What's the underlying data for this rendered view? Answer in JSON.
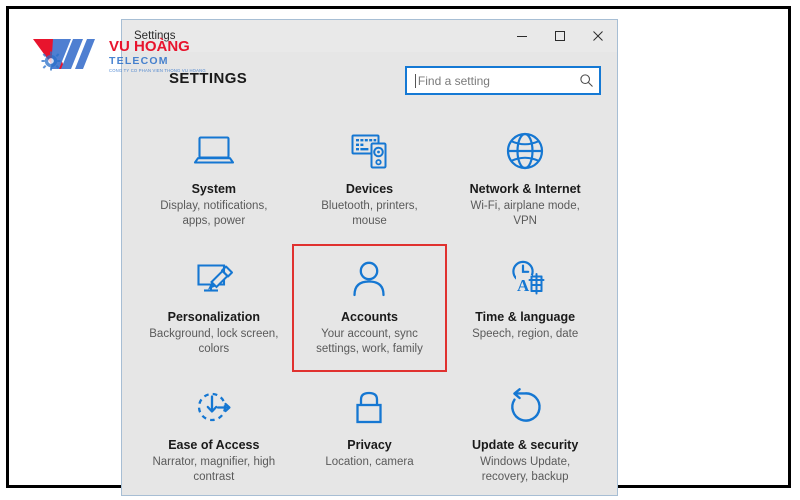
{
  "watermark": {
    "brand_line1_a": "VU ",
    "brand_line1_b": "HOÀNG",
    "brand_line2": "TELECOM",
    "brand_tagline": "CONG TY CO PHAN VIEN THONG VU HOANG",
    "color_red": "#e8142d",
    "color_blue": "#2a6fc9"
  },
  "window": {
    "title": "Settings",
    "controls": {
      "minimize": "minimize-icon",
      "maximize": "maximize-icon",
      "close": "close-icon"
    }
  },
  "header": {
    "title": "SETTINGS"
  },
  "search": {
    "value": "",
    "placeholder": "Find a setting",
    "icon": "search-icon",
    "accent_color": "#1579d4"
  },
  "accent_color": "#1577d2",
  "highlight_color": "#e0312f",
  "tiles": [
    {
      "id": "system",
      "icon": "laptop-icon",
      "title": "System",
      "desc": "Display, notifications, apps, power",
      "selected": false
    },
    {
      "id": "devices",
      "icon": "keyboard-device-icon",
      "title": "Devices",
      "desc": "Bluetooth, printers, mouse",
      "selected": false
    },
    {
      "id": "network-internet",
      "icon": "globe-icon",
      "title": "Network & Internet",
      "desc": "Wi-Fi, airplane mode, VPN",
      "selected": false
    },
    {
      "id": "personalization",
      "icon": "monitor-brush-icon",
      "title": "Personalization",
      "desc": "Background, lock screen, colors",
      "selected": false
    },
    {
      "id": "accounts",
      "icon": "person-icon",
      "title": "Accounts",
      "desc": "Your account, sync settings, work, family",
      "selected": true
    },
    {
      "id": "time-language",
      "icon": "clock-language-icon",
      "title": "Time & language",
      "desc": "Speech, region, date",
      "selected": false
    },
    {
      "id": "ease-of-access",
      "icon": "ease-of-access-icon",
      "title": "Ease of Access",
      "desc": "Narrator, magnifier, high contrast",
      "selected": false
    },
    {
      "id": "privacy",
      "icon": "lock-icon",
      "title": "Privacy",
      "desc": "Location, camera",
      "selected": false
    },
    {
      "id": "update-security",
      "icon": "refresh-icon",
      "title": "Update & security",
      "desc": "Windows Update, recovery, backup",
      "selected": false
    }
  ]
}
